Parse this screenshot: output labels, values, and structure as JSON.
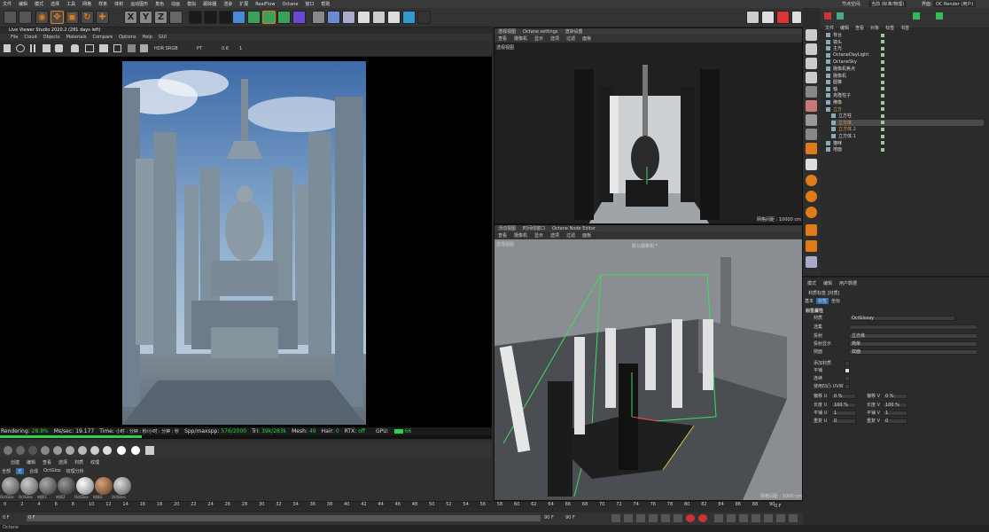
{
  "menubar": {
    "items": [
      "文件",
      "编辑",
      "模式",
      "选择",
      "工具",
      "网格",
      "样条",
      "体积",
      "运动图形",
      "角色",
      "动画",
      "模拟",
      "跟踪器",
      "渲染",
      "扩展",
      "RealFlow",
      "Octane",
      "窗口",
      "帮助"
    ],
    "right": {
      "node_space_label": "节点空间:",
      "node_space_value": "当前 (标准/物理)",
      "interface_label": "界面:",
      "interface_value": "OC Render (用户)"
    }
  },
  "toolbar": {
    "axis_x": "X",
    "axis_y": "Y",
    "axis_z": "Z"
  },
  "live_viewer": {
    "title": "Live Viewer Studio 2020.2 (281 days left)",
    "menu": [
      "File",
      "Cloud",
      "Objects",
      "Materials",
      "Compare",
      "Options",
      "Help",
      "GUI"
    ],
    "hdr": "HDR SRGB",
    "mode": "PT",
    "val1": "0.6",
    "val2": "1"
  },
  "status": {
    "rendering_label": "Rendering:",
    "rendering_value": "28.8%",
    "ms_label": "Ms/sec:",
    "ms_value": "19.177",
    "time_label": "Time:",
    "time_value": "小时 : 分钟 : 秒/小时 : 分钟 : 秒",
    "spp_label": "Spp/maxspp:",
    "spp_value": "576/2000",
    "tri_label": "Tri:",
    "tri_value": "39k/283k",
    "mesh_label": "Mesh:",
    "mesh_value": "49",
    "hair_label": "Hair:",
    "hair_value": "0",
    "rtx_label": "RTX:",
    "rtx_value": "off",
    "gpu_label": "GPU:",
    "gpu_value": "66",
    "progress": 0.288
  },
  "material_panel": {
    "menu": [
      "创建",
      "编辑",
      "查看",
      "选择",
      "材质",
      "纹理"
    ],
    "tabs": [
      "全部",
      "无",
      "合成",
      "OctGlos",
      "纹理分析"
    ],
    "materials": [
      "OctGlos",
      "OctGlos",
      "材质1",
      "材质2",
      "OctGlos",
      "材质3",
      "OctGlos"
    ]
  },
  "viewport_top": {
    "tabs": [
      "透视视图",
      "Octane settings",
      "渲染设置"
    ],
    "menu": [
      "查看",
      "摄像机",
      "显示",
      "选项",
      "过滤",
      "面板"
    ],
    "label": "透视视图",
    "grid": "网格间距 : 10000 cm"
  },
  "viewport_bottom": {
    "tabs": [
      "活动视图",
      "时间线窗口",
      "Octane Node Editor"
    ],
    "menu": [
      "查看",
      "摄像机",
      "显示",
      "选项",
      "过滤",
      "面板"
    ],
    "label": "透视视图",
    "camera": "默认摄像机 *",
    "grid": "网格间距 : 1000 cm"
  },
  "timeline": {
    "ticks": [
      "0",
      "2",
      "4",
      "6",
      "8",
      "10",
      "12",
      "14",
      "16",
      "18",
      "20",
      "22",
      "24",
      "26",
      "28",
      "30",
      "32",
      "34",
      "36",
      "38",
      "40",
      "42",
      "44",
      "46",
      "48",
      "50",
      "52",
      "54",
      "56",
      "58",
      "60",
      "62",
      "64",
      "66",
      "68",
      "70",
      "72",
      "74",
      "76",
      "78",
      "80",
      "82",
      "84",
      "86",
      "88",
      "90"
    ],
    "current": "0 F",
    "start": "0 F",
    "end": "90 F",
    "end2": "90 F",
    "right": "0 F"
  },
  "object_manager": {
    "menu": [
      "文件",
      "编辑",
      "查看",
      "对象",
      "标签",
      "书签"
    ],
    "objects": [
      "背台",
      "镜头",
      "主光",
      "OctaneDayLight",
      "OctaneSky",
      "摄像机焦点",
      "摄像机",
      "圆锥",
      "轴",
      "克隆柱子",
      "佛像",
      "立方",
      "立方柱",
      "立方体",
      "立方体.2",
      "立方体.1",
      "猫咪",
      "地面"
    ]
  },
  "attributes": {
    "menu": [
      "模式",
      "编辑",
      "用户数据"
    ],
    "title": "材质标签 [材质]",
    "tabs": [
      "基本",
      "标签",
      "坐标"
    ],
    "section": "标签属性",
    "material_label": "材质",
    "material_value": "OctGlossy",
    "rows": [
      {
        "label": "选集",
        "value": ""
      },
      {
        "label": "投射",
        "value": "立方体"
      },
      {
        "label": "投射显示",
        "value": "简单"
      },
      {
        "label": "侧面",
        "value": "双面"
      },
      {
        "label": "添加材质",
        "value": ""
      },
      {
        "label": "平铺",
        "value": ""
      },
      {
        "label": "连续",
        "value": ""
      },
      {
        "label": "使用凹凸 UVW",
        "value": ""
      }
    ],
    "offset_u": "0 %",
    "offset_v": "0 %",
    "length_u": "100 %",
    "length_v": "100 %",
    "tile_u": "1",
    "tile_v": "1",
    "repeat_u": "0",
    "repeat_v": "0",
    "offset_u_label": "偏移 U",
    "offset_v_label": "偏移 V",
    "length_u_label": "长度 U",
    "length_v_label": "长度 V",
    "tile_u_label": "平铺 U",
    "tile_v_label": "平铺 V",
    "repeat_u_label": "重复 U",
    "repeat_v_label": "重复 V"
  },
  "footer": {
    "label": "Octane"
  },
  "colors": {
    "accent": "#2bd24a",
    "orange": "#e07b1a",
    "green_box": "#3fdc5c"
  }
}
